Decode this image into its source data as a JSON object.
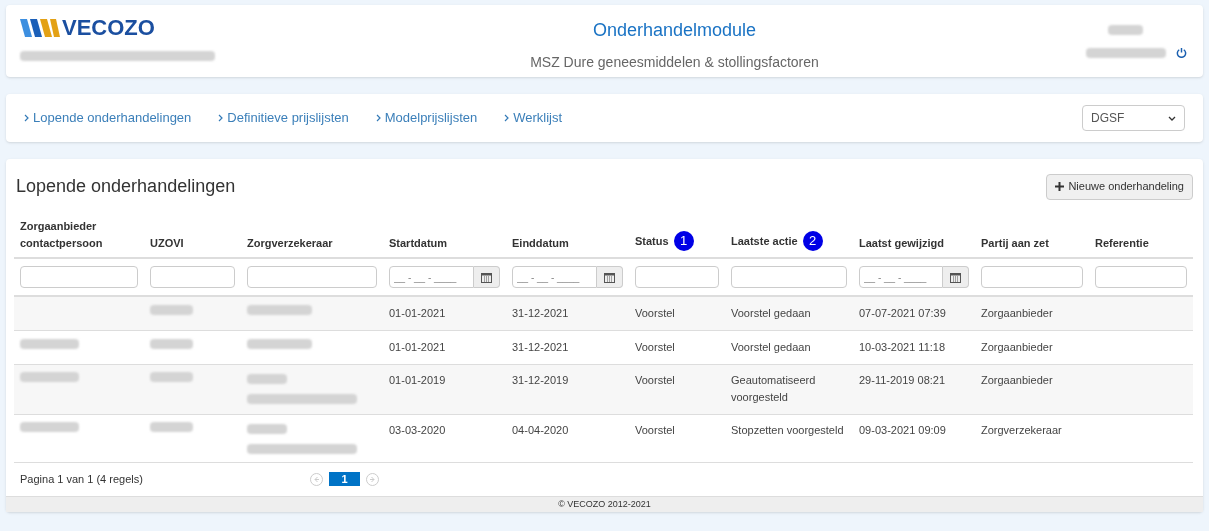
{
  "header": {
    "logo": "VECOZO",
    "title": "Onderhandelmodule",
    "subtitle": "MSZ Dure geneesmiddelen & stollingsfactoren"
  },
  "nav": {
    "links": [
      {
        "label": "Lopende onderhandelingen"
      },
      {
        "label": "Definitieve prijslijsten"
      },
      {
        "label": "Modelprijslijsten"
      },
      {
        "label": "Werklijst"
      }
    ],
    "select": {
      "value": "DGSF"
    }
  },
  "panel": {
    "title": "Lopende onderhandelingen",
    "new_button": "Nieuwe onderhandeling"
  },
  "table": {
    "columns": [
      {
        "label": "Zorgaanbieder contactpersoon",
        "kind": "text"
      },
      {
        "label": "UZOVI",
        "kind": "text"
      },
      {
        "label": "Zorgverzekeraar",
        "kind": "text"
      },
      {
        "label": "Startdatum",
        "kind": "date",
        "placeholder": "__ - __ - ____"
      },
      {
        "label": "Einddatum",
        "kind": "date",
        "placeholder": "__ - __ - ____"
      },
      {
        "label": "Status",
        "kind": "text",
        "marker": "1"
      },
      {
        "label": "Laatste actie",
        "kind": "text",
        "marker": "2"
      },
      {
        "label": "Laatst gewijzigd",
        "kind": "date",
        "placeholder": "__ - __ - ____"
      },
      {
        "label": "Partij aan zet",
        "kind": "text"
      },
      {
        "label": "Referentie",
        "kind": "text"
      }
    ],
    "rows": [
      {
        "cells": [
          {
            "kind": "empty"
          },
          {
            "kind": "redacted"
          },
          {
            "kind": "redacted"
          },
          {
            "kind": "text",
            "text": "01-01-2021"
          },
          {
            "kind": "text",
            "text": "31-12-2021"
          },
          {
            "kind": "text",
            "text": "Voorstel"
          },
          {
            "kind": "text",
            "text": "Voorstel gedaan"
          },
          {
            "kind": "text",
            "text": "07-07-2021 07:39"
          },
          {
            "kind": "text",
            "text": "Zorgaanbieder"
          },
          {
            "kind": "empty"
          }
        ]
      },
      {
        "cells": [
          {
            "kind": "redacted"
          },
          {
            "kind": "redacted"
          },
          {
            "kind": "redacted"
          },
          {
            "kind": "text",
            "text": "01-01-2021"
          },
          {
            "kind": "text",
            "text": "31-12-2021"
          },
          {
            "kind": "text",
            "text": "Voorstel"
          },
          {
            "kind": "text",
            "text": "Voorstel gedaan"
          },
          {
            "kind": "text",
            "text": "10-03-2021 11:18"
          },
          {
            "kind": "text",
            "text": "Zorgaanbieder"
          },
          {
            "kind": "empty"
          }
        ]
      },
      {
        "cells": [
          {
            "kind": "redacted"
          },
          {
            "kind": "redacted"
          },
          {
            "kind": "redacted2"
          },
          {
            "kind": "text",
            "text": "01-01-2019"
          },
          {
            "kind": "text",
            "text": "31-12-2019"
          },
          {
            "kind": "text",
            "text": "Voorstel"
          },
          {
            "kind": "text",
            "text": "Geautomatiseerd voorgesteld"
          },
          {
            "kind": "text",
            "text": "29-11-2019 08:21"
          },
          {
            "kind": "text",
            "text": "Zorgaanbieder"
          },
          {
            "kind": "empty"
          }
        ]
      },
      {
        "cells": [
          {
            "kind": "redacted"
          },
          {
            "kind": "redacted"
          },
          {
            "kind": "redacted2"
          },
          {
            "kind": "text",
            "text": "03-03-2020"
          },
          {
            "kind": "text",
            "text": "04-04-2020"
          },
          {
            "kind": "text",
            "text": "Voorstel"
          },
          {
            "kind": "text",
            "text": "Stopzetten voorgesteld"
          },
          {
            "kind": "text",
            "text": "09-03-2021 09:09"
          },
          {
            "kind": "text",
            "text": "Zorgverzekeraar"
          },
          {
            "kind": "empty"
          }
        ]
      }
    ]
  },
  "pagination": {
    "summary": "Pagina 1 van 1 (4 regels)",
    "pages": [
      {
        "label": "1",
        "selected": true
      }
    ]
  },
  "footer": "© VECOZO 2012-2021"
}
